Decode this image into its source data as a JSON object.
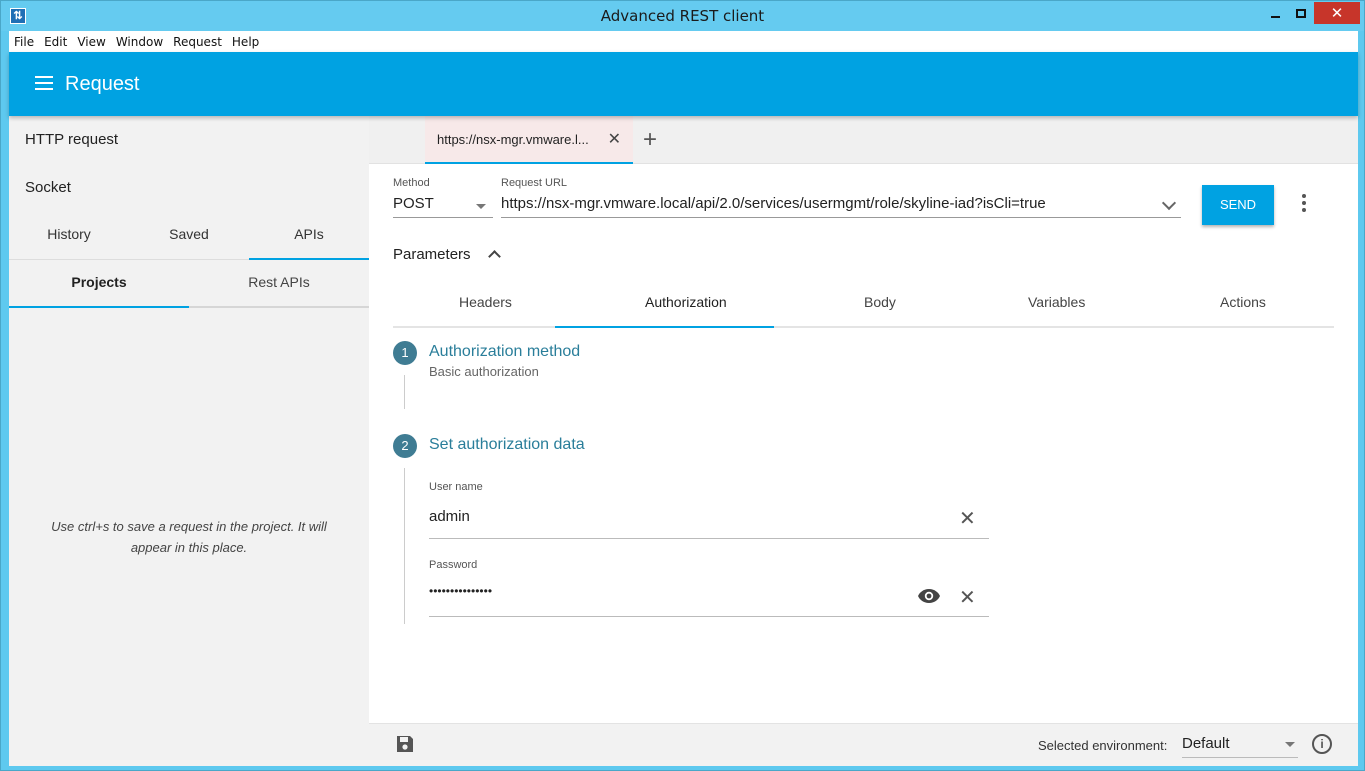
{
  "window": {
    "title": "Advanced REST client"
  },
  "menubar": [
    "File",
    "Edit",
    "View",
    "Window",
    "Request",
    "Help"
  ],
  "appbar": {
    "title": "Request"
  },
  "sidebar": {
    "nav": [
      "HTTP request",
      "Socket"
    ],
    "tabs": [
      "History",
      "Saved",
      "APIs"
    ],
    "active_tab": "APIs",
    "subtabs": [
      "Projects",
      "Rest APIs"
    ],
    "active_subtab": "Projects",
    "empty_message": "Use ctrl+s to save a request in the project. It will appear in this place."
  },
  "request_tab": {
    "label": "https://nsx-mgr.vmware.l..."
  },
  "request": {
    "method_label": "Method",
    "method": "POST",
    "url_label": "Request URL",
    "url": "https://nsx-mgr.vmware.local/api/2.0/services/usermgmt/role/skyline-iad?isCli=true",
    "send_label": "SEND"
  },
  "parameters": {
    "label": "Parameters",
    "tabs": [
      "Headers",
      "Authorization",
      "Body",
      "Variables",
      "Actions"
    ],
    "active_tab": "Authorization"
  },
  "auth": {
    "step1": {
      "number": "1",
      "title": "Authorization method",
      "value": "Basic authorization"
    },
    "step2": {
      "number": "2",
      "title": "Set authorization data"
    },
    "username_label": "User name",
    "username": "admin",
    "password_label": "Password",
    "password_masked": "•••••••••••••••"
  },
  "footer": {
    "env_label": "Selected environment:",
    "env_value": "Default"
  },
  "colors": {
    "accent": "#00a2e2",
    "step": "#3f7c93",
    "title_bar": "#65cbf0"
  }
}
